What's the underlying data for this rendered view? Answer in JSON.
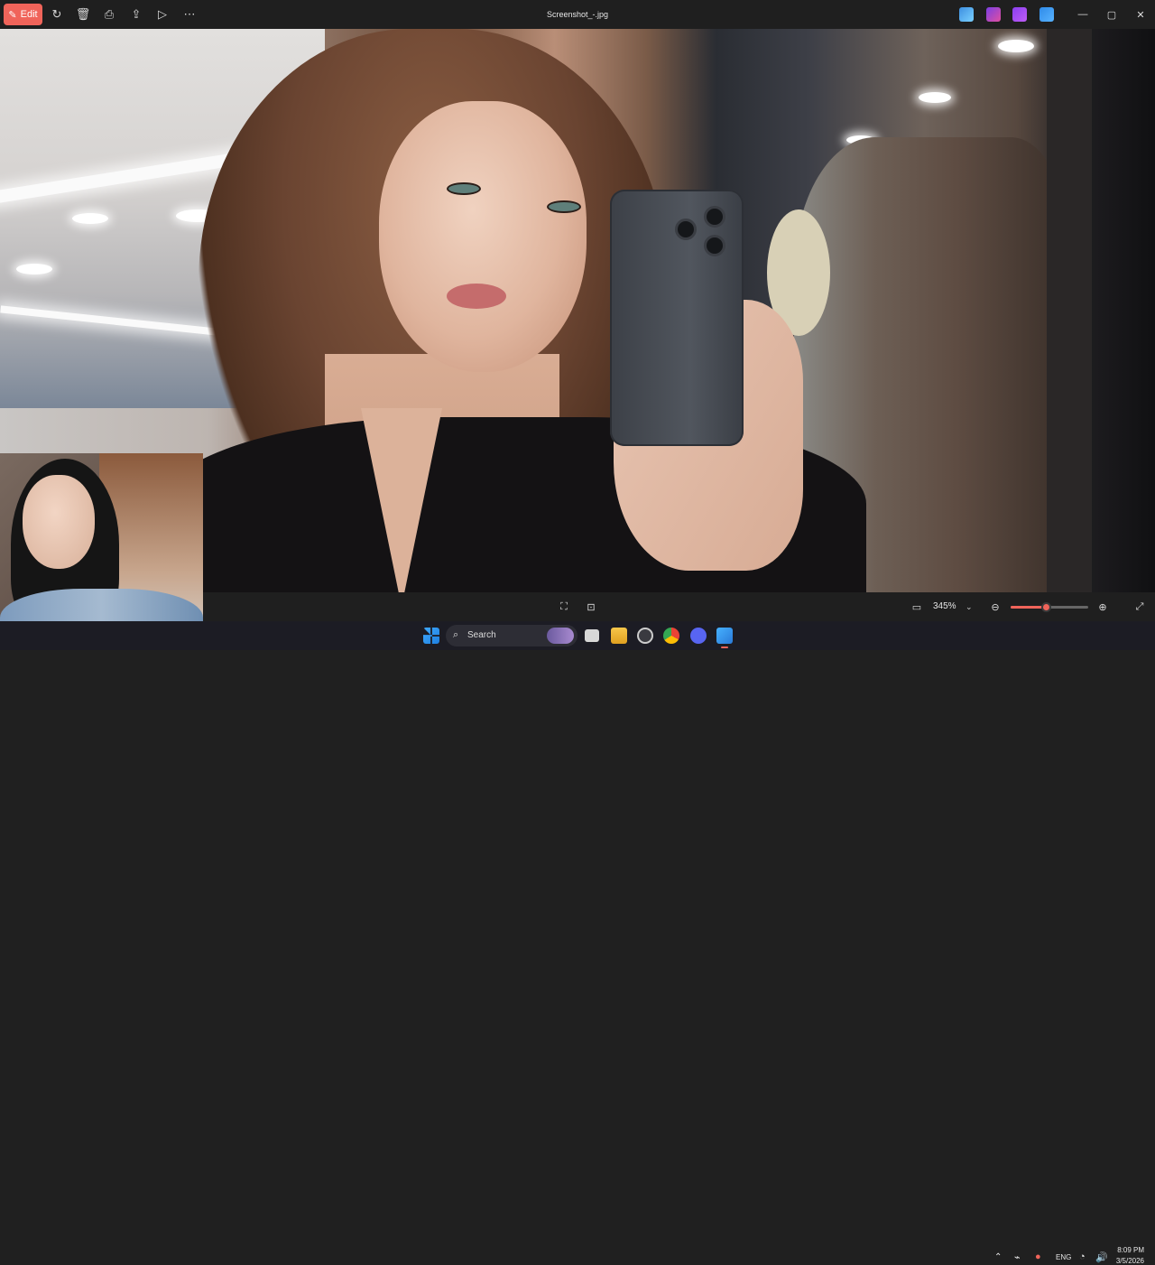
{
  "window": {
    "title": "Screenshot_-.jpg",
    "edit_label": "Edit",
    "toolbar_icons": [
      "rotate-icon",
      "delete-icon",
      "print-icon",
      "share-icon",
      "slideshow-icon",
      "more-icon"
    ],
    "extension_icons": [
      "designer-icon",
      "clipchamp-icon",
      "app-icon",
      "onedrive-icon"
    ],
    "window_controls": [
      "minimize-icon",
      "maximize-icon",
      "close-icon"
    ]
  },
  "status_bar": {
    "zoom_level": "345%",
    "zoom_fraction": 0.45,
    "center_icons": [
      "fit-to-window-icon",
      "select-region-icon"
    ],
    "right_icons": [
      "actual-size-icon",
      "zoom-out-icon",
      "zoom-in-icon",
      "fullscreen-icon"
    ]
  },
  "taskbar": {
    "search_placeholder": "Search",
    "apps": [
      "windows-start-icon",
      "task-view-icon",
      "file-explorer-icon",
      "app-icon",
      "chrome-icon",
      "discord-icon",
      "photos-icon"
    ],
    "tray": {
      "language": "ENG",
      "time": "8:09 PM",
      "date": "3/5/2026"
    }
  },
  "colors": {
    "accent": "#f0645a",
    "titlebar": "#1f1f1f",
    "taskbar": "#1c1c24"
  }
}
